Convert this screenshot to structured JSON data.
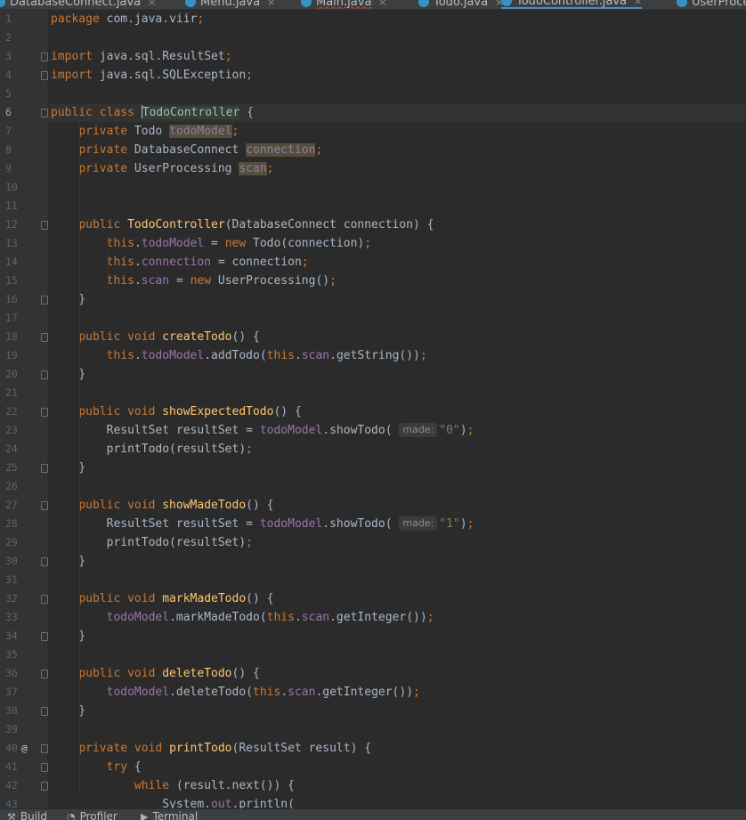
{
  "tabs": [
    {
      "label": "DatabaseConnect.java",
      "active": false
    },
    {
      "label": "Menu.java",
      "active": false
    },
    {
      "label": "Main.java",
      "active": false,
      "warning": true
    },
    {
      "label": "Todo.java",
      "active": false
    },
    {
      "label": "TodoController.java",
      "active": true
    },
    {
      "label": "UserProce",
      "active": false
    }
  ],
  "editor": {
    "current_line": 6,
    "lines": [
      {
        "n": "1",
        "html": "<span class=\"kw\">package</span> com.java.viir<span class=\"kw\">;</span>"
      },
      {
        "n": "2",
        "html": ""
      },
      {
        "n": "3",
        "fold": true,
        "html": "<span class=\"kw\">import</span> java.sql.ResultSet<span class=\"kw\">;</span>"
      },
      {
        "n": "4",
        "fold": true,
        "html": "<span class=\"kw\">import</span> java.sql.SQLException<span class=\"kw\">;</span>"
      },
      {
        "n": "5",
        "html": ""
      },
      {
        "n": "6",
        "fold": true,
        "html": "<span class=\"kw\">public class</span> <span class=\"caret\"></span><span class=\"hl1\">TodoController</span> {"
      },
      {
        "n": "7",
        "html": "    <span class=\"kw\">private</span> Todo <span class=\"fld hl2\">todoModel</span><span class=\"kw\">;</span>"
      },
      {
        "n": "8",
        "html": "    <span class=\"kw\">private</span> DatabaseConnect <span class=\"fld hl2\">connection</span><span class=\"kw\">;</span>"
      },
      {
        "n": "9",
        "html": "    <span class=\"kw\">private</span> UserProcessing <span class=\"fld hl2\">scan</span><span class=\"kw\">;</span>"
      },
      {
        "n": "10",
        "html": ""
      },
      {
        "n": "11",
        "html": ""
      },
      {
        "n": "12",
        "fold": true,
        "html": "    <span class=\"kw\">public</span> <span class=\"fn\">TodoController</span>(DatabaseConnect connection) {"
      },
      {
        "n": "13",
        "html": "        <span class=\"kw\">this</span>.<span class=\"fld\">todoModel</span> = <span class=\"kw\">new</span> Todo(connection)<span class=\"kw\">;</span>"
      },
      {
        "n": "14",
        "html": "        <span class=\"kw\">this</span>.<span class=\"fld\">connection</span> = connection<span class=\"kw\">;</span>"
      },
      {
        "n": "15",
        "html": "        <span class=\"kw\">this</span>.<span class=\"fld\">scan</span> = <span class=\"kw\">new</span> UserProcessing()<span class=\"kw\">;</span>"
      },
      {
        "n": "16",
        "fold": true,
        "html": "    }"
      },
      {
        "n": "17",
        "html": ""
      },
      {
        "n": "18",
        "fold": true,
        "html": "    <span class=\"kw\">public void</span> <span class=\"fn\">createTodo</span>() {"
      },
      {
        "n": "19",
        "html": "        <span class=\"kw\">this</span>.<span class=\"fld\">todoModel</span>.addTodo(<span class=\"kw\">this</span>.<span class=\"fld\">scan</span>.getString())<span class=\"kw\">;</span>"
      },
      {
        "n": "20",
        "fold": true,
        "html": "    }"
      },
      {
        "n": "21",
        "html": ""
      },
      {
        "n": "22",
        "fold": true,
        "html": "    <span class=\"kw\">public void</span> <span class=\"fn\">showExpectedTodo</span>() {"
      },
      {
        "n": "23",
        "html": "        ResultSet resultSet = <span class=\"fld\">todoModel</span>.showTodo( <span class=\"hint\">made:</span><span class=\"str\">\"0\"</span>)<span class=\"kw\">;</span>"
      },
      {
        "n": "24",
        "html": "        printTodo(resultSet)<span class=\"kw\">;</span>"
      },
      {
        "n": "25",
        "fold": true,
        "html": "    }"
      },
      {
        "n": "26",
        "html": ""
      },
      {
        "n": "27",
        "fold": true,
        "html": "    <span class=\"kw\">public void</span> <span class=\"fn\">showMadeTodo</span>() {"
      },
      {
        "n": "28",
        "html": "        ResultSet resultSet = <span class=\"fld\">todoModel</span>.showTodo( <span class=\"hint\">made:</span><span class=\"str\">\"1\"</span>)<span class=\"kw\">;</span>"
      },
      {
        "n": "29",
        "html": "        printTodo(resultSet)<span class=\"kw\">;</span>"
      },
      {
        "n": "30",
        "fold": true,
        "html": "    }"
      },
      {
        "n": "31",
        "html": ""
      },
      {
        "n": "32",
        "fold": true,
        "html": "    <span class=\"kw\">public void</span> <span class=\"fn\">markMadeTodo</span>() {"
      },
      {
        "n": "33",
        "html": "        <span class=\"fld\">todoModel</span>.markMadeTodo(<span class=\"kw\">this</span>.<span class=\"fld\">scan</span>.getInteger())<span class=\"kw\">;</span>"
      },
      {
        "n": "34",
        "fold": true,
        "html": "    }"
      },
      {
        "n": "35",
        "html": ""
      },
      {
        "n": "36",
        "fold": true,
        "html": "    <span class=\"kw\">public void</span> <span class=\"fn\">deleteTodo</span>() {"
      },
      {
        "n": "37",
        "html": "        <span class=\"fld\">todoModel</span>.deleteTodo(<span class=\"kw\">this</span>.<span class=\"fld\">scan</span>.getInteger())<span class=\"kw\">;</span>"
      },
      {
        "n": "38",
        "fold": true,
        "html": "    }"
      },
      {
        "n": "39",
        "html": ""
      },
      {
        "n": "40",
        "fold": true,
        "mark": "@",
        "html": "    <span class=\"kw\">private void</span> <span class=\"fn\">printTodo</span>(ResultSet result) {"
      },
      {
        "n": "41",
        "fold": true,
        "html": "        <span class=\"kw\">try</span> {"
      },
      {
        "n": "42",
        "fold": true,
        "html": "            <span class=\"kw\">while</span> (result.next()) {"
      },
      {
        "n": "43",
        "html": "                System.<span class=\"fld\">out</span>.println("
      }
    ]
  },
  "bottom_bar": [
    {
      "label": "Build",
      "icon": "hammer-icon",
      "glyph": "⚒"
    },
    {
      "label": "Profiler",
      "icon": "profiler-icon",
      "glyph": "◔"
    },
    {
      "label": "Terminal",
      "icon": "terminal-icon",
      "glyph": "▶"
    }
  ]
}
